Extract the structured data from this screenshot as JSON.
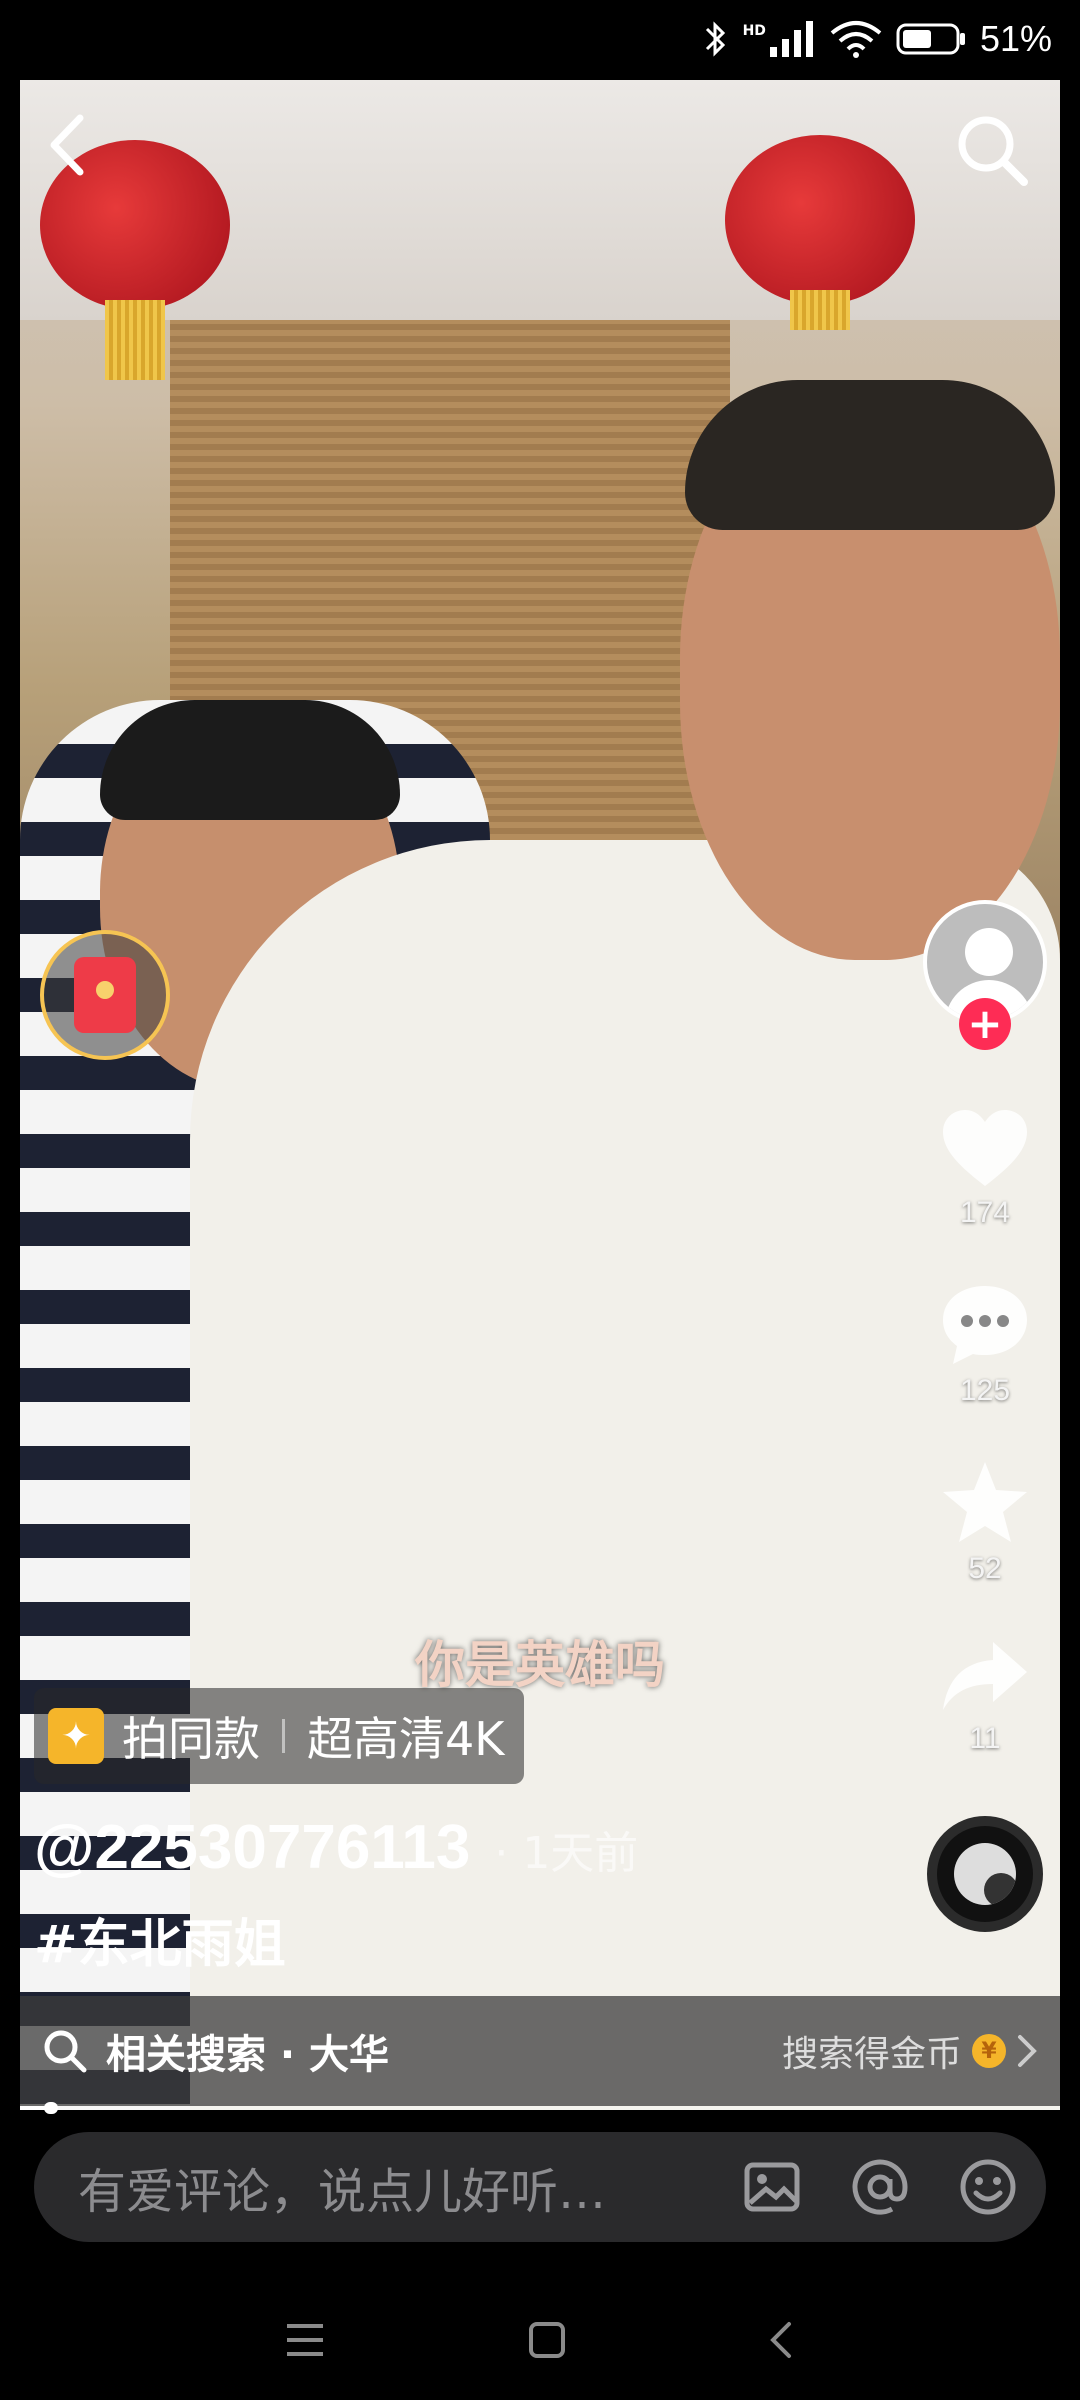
{
  "status_bar": {
    "network_label": "HD",
    "battery_text": "51%"
  },
  "video": {
    "subtitle": "你是英雄吗",
    "effect_tag": {
      "label": "拍同款",
      "quality": "超高清4K"
    },
    "author": "@22530776113",
    "time_ago": "· 1天前",
    "hashtag": "#东北雨姐"
  },
  "rail": {
    "follow_symbol": "+",
    "likes": "174",
    "comments": "125",
    "favorites": "52",
    "shares": "11"
  },
  "related_search": {
    "label": "相关搜索 · 大华",
    "reward_text": "搜索得金币",
    "coin_symbol": "¥"
  },
  "comment_bar": {
    "placeholder": "有爱评论，说点儿好听…"
  },
  "progress": 0.03,
  "icons": [
    "back-icon",
    "search-icon",
    "red-packet-icon",
    "heart-icon",
    "comment-icon",
    "star-icon",
    "share-icon",
    "music-disc-icon",
    "image-icon",
    "at-icon",
    "emoji-icon",
    "menu-icon",
    "home-icon",
    "nav-back-icon"
  ]
}
